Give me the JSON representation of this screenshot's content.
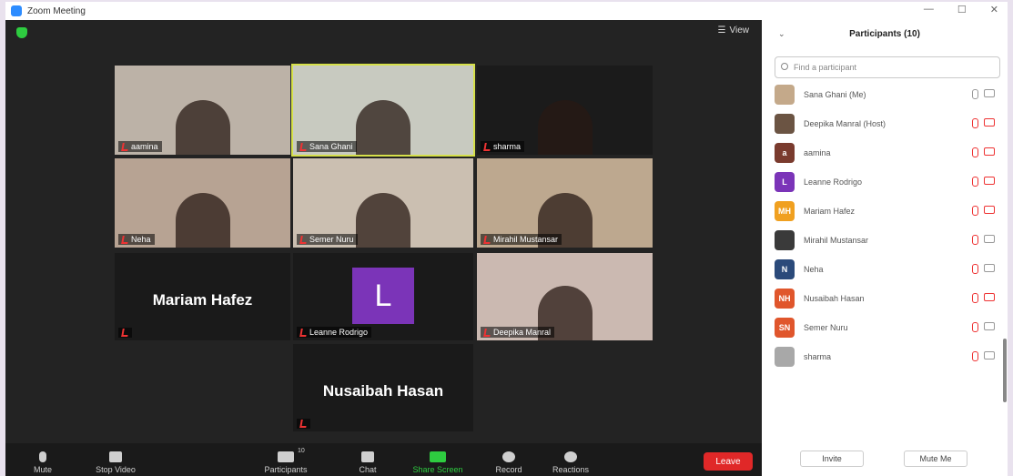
{
  "window": {
    "title": "Zoom Meeting",
    "controls": [
      "—",
      "☐",
      "✕"
    ]
  },
  "top": {
    "view_label": "View"
  },
  "tiles": [
    {
      "name": "aamina",
      "bg": "#bcb2a7"
    },
    {
      "name": "Sana Ghani",
      "bg": "#c8cac0"
    },
    {
      "name": "sharma",
      "bg": "#1b1b1b"
    },
    {
      "name": "Neha",
      "bg": "#b7a393"
    },
    {
      "name": "Semer Nuru",
      "bg": "#cbbfb1"
    },
    {
      "name": "Mirahil Mustansar",
      "bg": "#bda88f"
    },
    {
      "name": "Mariam Hafez",
      "big": true
    },
    {
      "name": "Leanne Rodrigo",
      "avatar": "L"
    },
    {
      "name": "Deepika Manral",
      "bg": "#cbb9b1"
    },
    {
      "name": "Nusaibah Hasan",
      "big": true
    }
  ],
  "controls": {
    "mute": "Mute",
    "stop_video": "Stop Video",
    "participants": "Participants",
    "participants_count": "10",
    "chat": "Chat",
    "share_screen": "Share Screen",
    "record": "Record",
    "reactions": "Reactions",
    "leave": "Leave"
  },
  "panel": {
    "title": "Participants (10)",
    "search_placeholder": "Find a participant",
    "invite": "Invite",
    "mute_me": "Mute Me",
    "participants": [
      {
        "name": "Sana Ghani (Me)",
        "avatar": "",
        "color": "#c4a98a",
        "mic_muted": false,
        "cam_muted": false
      },
      {
        "name": "Deepika Manral (Host)",
        "avatar": "",
        "color": "#6b5443",
        "mic_muted": true,
        "cam_muted": true
      },
      {
        "name": "aamina",
        "avatar": "a",
        "color": "#7a3b2e",
        "mic_muted": true,
        "cam_muted": true
      },
      {
        "name": "Leanne Rodrigo",
        "avatar": "L",
        "color": "#7b34b8",
        "mic_muted": true,
        "cam_muted": true
      },
      {
        "name": "Mariam Hafez",
        "avatar": "MH",
        "color": "#f0a020",
        "mic_muted": true,
        "cam_muted": true
      },
      {
        "name": "Mirahil Mustansar",
        "avatar": "",
        "color": "#3a3a3a",
        "mic_muted": true,
        "cam_muted": false
      },
      {
        "name": "Neha",
        "avatar": "N",
        "color": "#2b4a7a",
        "mic_muted": true,
        "cam_muted": false
      },
      {
        "name": "Nusaibah Hasan",
        "avatar": "NH",
        "color": "#e0562c",
        "mic_muted": true,
        "cam_muted": true
      },
      {
        "name": "Semer Nuru",
        "avatar": "SN",
        "color": "#e0562c",
        "mic_muted": true,
        "cam_muted": false
      },
      {
        "name": "sharma",
        "avatar": "",
        "color": "#a8a8a8",
        "mic_muted": true,
        "cam_muted": false
      }
    ]
  }
}
